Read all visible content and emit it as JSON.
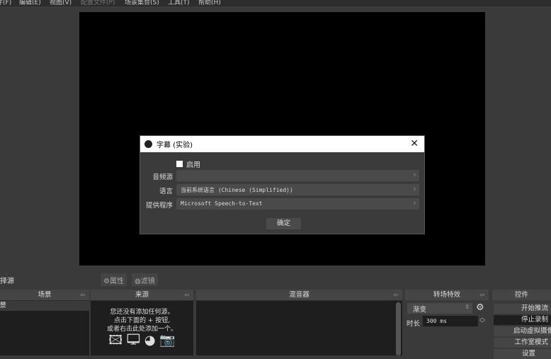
{
  "menu": [
    "文件(F)",
    "编辑(E)",
    "视图(V)",
    "配置文件(P)",
    "场景集合(S)",
    "工具(T)",
    "帮助(H)"
  ],
  "dialog": {
    "title": "字幕 (实验)",
    "enable_label": "启用",
    "audio_source_label": "音频源",
    "audio_source_value": "",
    "language_label": "语言",
    "language_value": "当前系统语言 (Chinese (Simplified))",
    "provider_label": "提供程序",
    "provider_value": "Microsoft Speech-to-Text",
    "ok": "确定"
  },
  "toolbar": {
    "no_source": "未选择源",
    "properties": "属性",
    "filters": "滤镜"
  },
  "docks": {
    "scenes": {
      "title": "场景",
      "items": [
        "场景"
      ]
    },
    "sources": {
      "title": "来源",
      "empty": [
        "您还没有添加任何源。",
        "点击下面的 + 按钮,",
        "或者右击此处添加一个。"
      ]
    },
    "mixer": {
      "title": "混音器"
    },
    "transitions": {
      "title": "转场特效",
      "type": "渐变",
      "duration_label": "时长",
      "duration": "300 ms"
    },
    "controls": {
      "title": "控件",
      "buttons": [
        "开始推流",
        "停止录制",
        "启动虚拟摄像机",
        "工作室模式",
        "设置"
      ]
    }
  }
}
